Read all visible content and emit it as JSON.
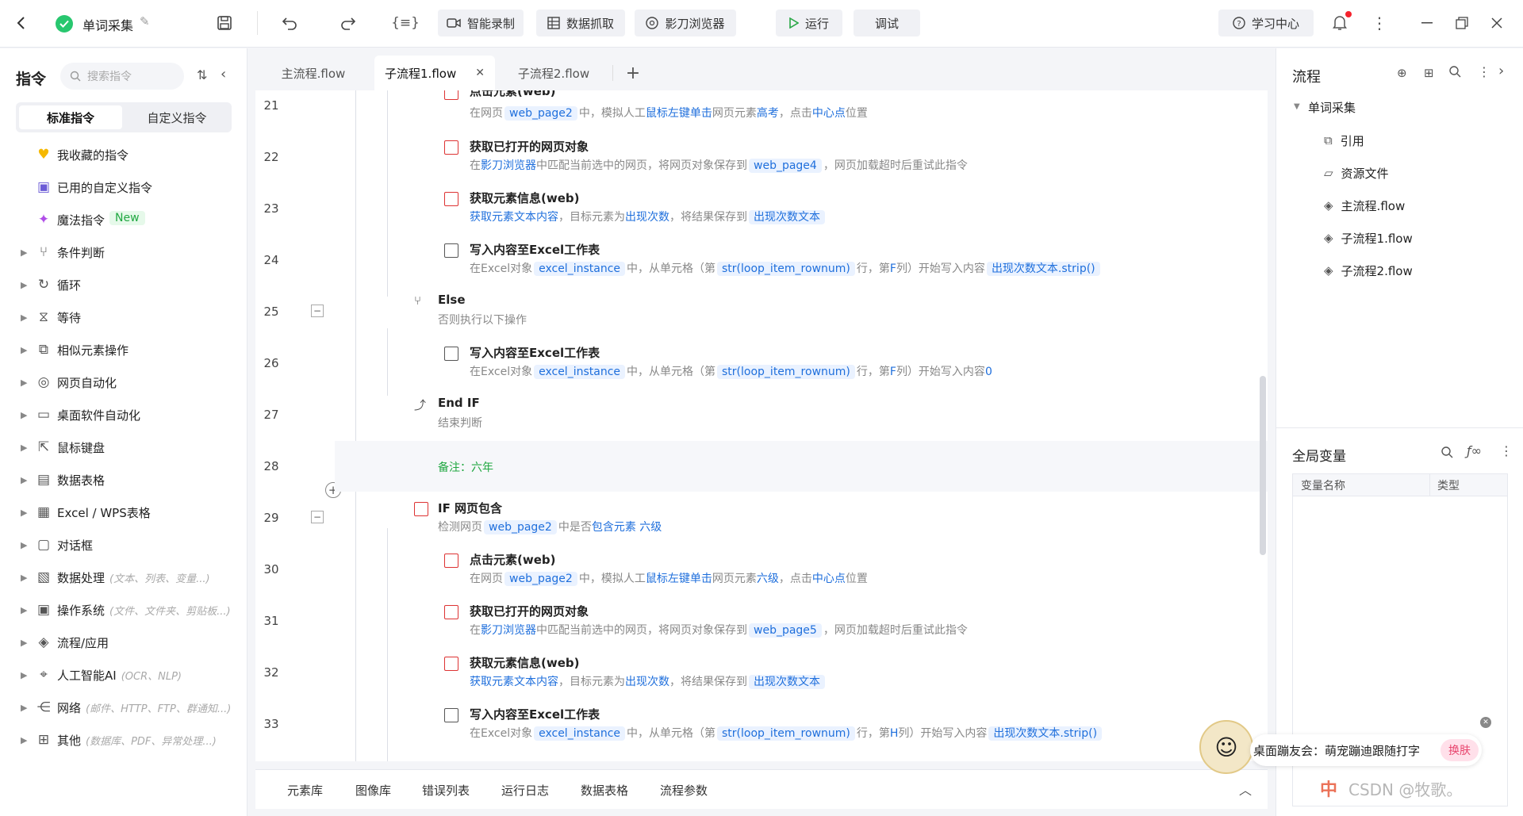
{
  "titlebar": {
    "project_name": "单词采集",
    "smart_record": "智能录制",
    "data_capture": "数据抓取",
    "browser": "影刀浏览器",
    "run": "运行",
    "debug": "调试",
    "learning_center": "学习中心"
  },
  "left": {
    "title": "指令",
    "search_placeholder": "搜索指令",
    "tab_standard": "标准指令",
    "tab_custom": "自定义指令",
    "items": [
      {
        "label": "我收藏的指令",
        "hint": ""
      },
      {
        "label": "已用的自定义指令",
        "hint": ""
      },
      {
        "label": "魔法指令",
        "hint": "",
        "badge": "New"
      },
      {
        "label": "条件判断",
        "hint": ""
      },
      {
        "label": "循环",
        "hint": ""
      },
      {
        "label": "等待",
        "hint": ""
      },
      {
        "label": "相似元素操作",
        "hint": ""
      },
      {
        "label": "网页自动化",
        "hint": ""
      },
      {
        "label": "桌面软件自动化",
        "hint": ""
      },
      {
        "label": "鼠标键盘",
        "hint": ""
      },
      {
        "label": "数据表格",
        "hint": ""
      },
      {
        "label": "Excel / WPS表格",
        "hint": ""
      },
      {
        "label": "对话框",
        "hint": ""
      },
      {
        "label": "数据处理",
        "hint": "(文本、列表、变量...)"
      },
      {
        "label": "操作系统",
        "hint": "(文件、文件夹、剪贴板...)"
      },
      {
        "label": "流程/应用",
        "hint": ""
      },
      {
        "label": "人工智能AI",
        "hint": "(OCR、NLP)"
      },
      {
        "label": "网络",
        "hint": "(邮件、HTTP、FTP、群通知...)"
      },
      {
        "label": "其他",
        "hint": "(数据库、PDF、异常处理...)"
      }
    ]
  },
  "tabs": [
    "主流程.flow",
    "子流程1.flow",
    "子流程2.flow"
  ],
  "editor": {
    "lines": [
      "21",
      "22",
      "23",
      "24",
      "25",
      "26",
      "27",
      "28",
      "29",
      "30",
      "31",
      "32",
      "33"
    ],
    "top_partial_title": "点击元素(web)",
    "l21": {
      "a": "在网页",
      "v1": "web_page2",
      "b": "中，模拟人工",
      "k1": "鼠标左键单击",
      "c": "网页元素",
      "k2": "高考",
      "d": "，点击",
      "k3": "中心点",
      "e": "位置"
    },
    "l22": {
      "title": "获取已打开的网页对象",
      "a": "在",
      "k1": "影刀浏览器",
      "b": "中匹配当前选中的网页，将网页对象保存到",
      "v1": "web_page4",
      "c": "，网页加载超时后重试此指令"
    },
    "l23": {
      "title": "获取元素信息(web)",
      "k1": "获取元素文本内容",
      "a": "，目标元素为",
      "k2": "出现次数",
      "b": "，将结果保存到",
      "v1": "出现次数文本"
    },
    "l24": {
      "title": "写入内容至Excel工作表",
      "a": "在Excel对象",
      "v1": "excel_instance",
      "b": "中，从单元格（第",
      "v2": "str(loop_item_rownum)",
      "c": "行，第",
      "k1": "F",
      "d": "列）开始写入内容",
      "v3": "出现次数文本.strip()"
    },
    "l25": {
      "title": "Else",
      "desc": "否则执行以下操作"
    },
    "l26": {
      "title": "写入内容至Excel工作表",
      "a": "在Excel对象",
      "v1": "excel_instance",
      "b": "中，从单元格（第",
      "v2": "str(loop_item_rownum)",
      "c": "行，第",
      "k1": "F",
      "d": "列）开始写入内容",
      "k2": "0"
    },
    "l27": {
      "title": "End IF",
      "desc": "结束判断"
    },
    "l28": {
      "note": "备注：六年"
    },
    "l29": {
      "title": "IF 网页包含",
      "a": "检测网页",
      "v1": "web_page2",
      "b": "中是否",
      "k1": "包含元素",
      "k2": "六级"
    },
    "l30": {
      "title": "点击元素(web)",
      "a": "在网页",
      "v1": "web_page2",
      "b": "中，模拟人工",
      "k1": "鼠标左键单击",
      "c": "网页元素",
      "k2": "六级",
      "d": "，点击",
      "k3": "中心点",
      "e": "位置"
    },
    "l31": {
      "title": "获取已打开的网页对象",
      "a": "在",
      "k1": "影刀浏览器",
      "b": "中匹配当前选中的网页，将网页对象保存到",
      "v1": "web_page5",
      "c": "，网页加载超时后重试此指令"
    },
    "l32": {
      "title": "获取元素信息(web)",
      "k1": "获取元素文本内容",
      "a": "，目标元素为",
      "k2": "出现次数",
      "b": "，将结果保存到",
      "v1": "出现次数文本"
    },
    "l33": {
      "title": "写入内容至Excel工作表",
      "a": "在Excel对象",
      "v1": "excel_instance",
      "b": "中，从单元格（第",
      "v2": "str(loop_item_rownum)",
      "c": "行，第",
      "k1": "H",
      "d": "列）开始写入内容",
      "v3": "出现次数文本.strip()"
    }
  },
  "bottom": [
    "元素库",
    "图像库",
    "错误列表",
    "运行日志",
    "数据表格",
    "流程参数"
  ],
  "right": {
    "flow_title": "流程",
    "root": "单词采集",
    "items": [
      "引用",
      "资源文件",
      "主流程.flow",
      "子流程1.flow",
      "子流程2.flow"
    ],
    "globals_title": "全局变量",
    "col_name": "变量名称",
    "col_type": "类型"
  },
  "popup": {
    "text": "桌面蹦友会：萌宠蹦迪跟随打字",
    "button": "换肤"
  },
  "watermark": "CSDN @牧歌。",
  "ime": "中"
}
